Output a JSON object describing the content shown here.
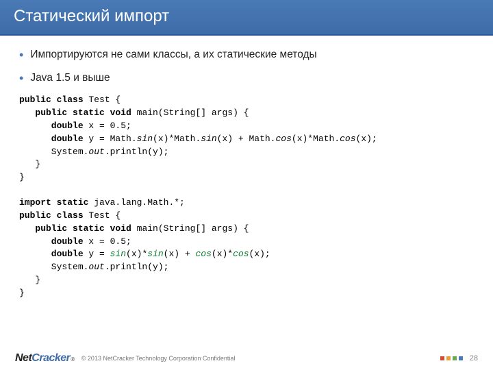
{
  "title": "Статический импорт",
  "bullets": [
    "Импортируются не сами классы, а их статические методы",
    "Java 1.5 и выше"
  ],
  "code1": {
    "l1a": "public",
    "l1b": " class",
    "l1c": " Test {",
    "l2a": "   public",
    "l2b": " static",
    "l2c": " void",
    "l2d": " main(String[] args) {",
    "l3a": "      double",
    "l3b": " x = 0.5;",
    "l4a": "      double",
    "l4b": " y = Math.",
    "l4c": "sin",
    "l4d": "(x)*Math.",
    "l4e": "sin",
    "l4f": "(x) + Math.",
    "l4g": "cos",
    "l4h": "(x)*Math.",
    "l4i": "cos",
    "l4j": "(x);",
    "l5a": "      System.",
    "l5b": "out",
    "l5c": ".println(y);",
    "l6": "   }",
    "l7": "}"
  },
  "code2": {
    "l1a": "import",
    "l1b": " static",
    "l1c": " java.lang.Math.*;",
    "l2a": "public",
    "l2b": " class",
    "l2c": " Test {",
    "l3a": "   public",
    "l3b": " static",
    "l3c": " void",
    "l3d": " main(String[] args) {",
    "l4a": "      double",
    "l4b": " x = 0.5;",
    "l5a": "      double",
    "l5b": " y = ",
    "l5c": "sin",
    "l5d": "(x)*",
    "l5e": "sin",
    "l5f": "(x) + ",
    "l5g": "cos",
    "l5h": "(x)*",
    "l5i": "cos",
    "l5j": "(x);",
    "l6a": "      System.",
    "l6b": "out",
    "l6c": ".println(y);",
    "l7": "   }",
    "l8": "}"
  },
  "footer": {
    "logo_net": "Net",
    "logo_cracker": "Cracker",
    "reg": "®",
    "copyright": "© 2013 NetCracker Technology Corporation Confidential",
    "page": "28"
  }
}
